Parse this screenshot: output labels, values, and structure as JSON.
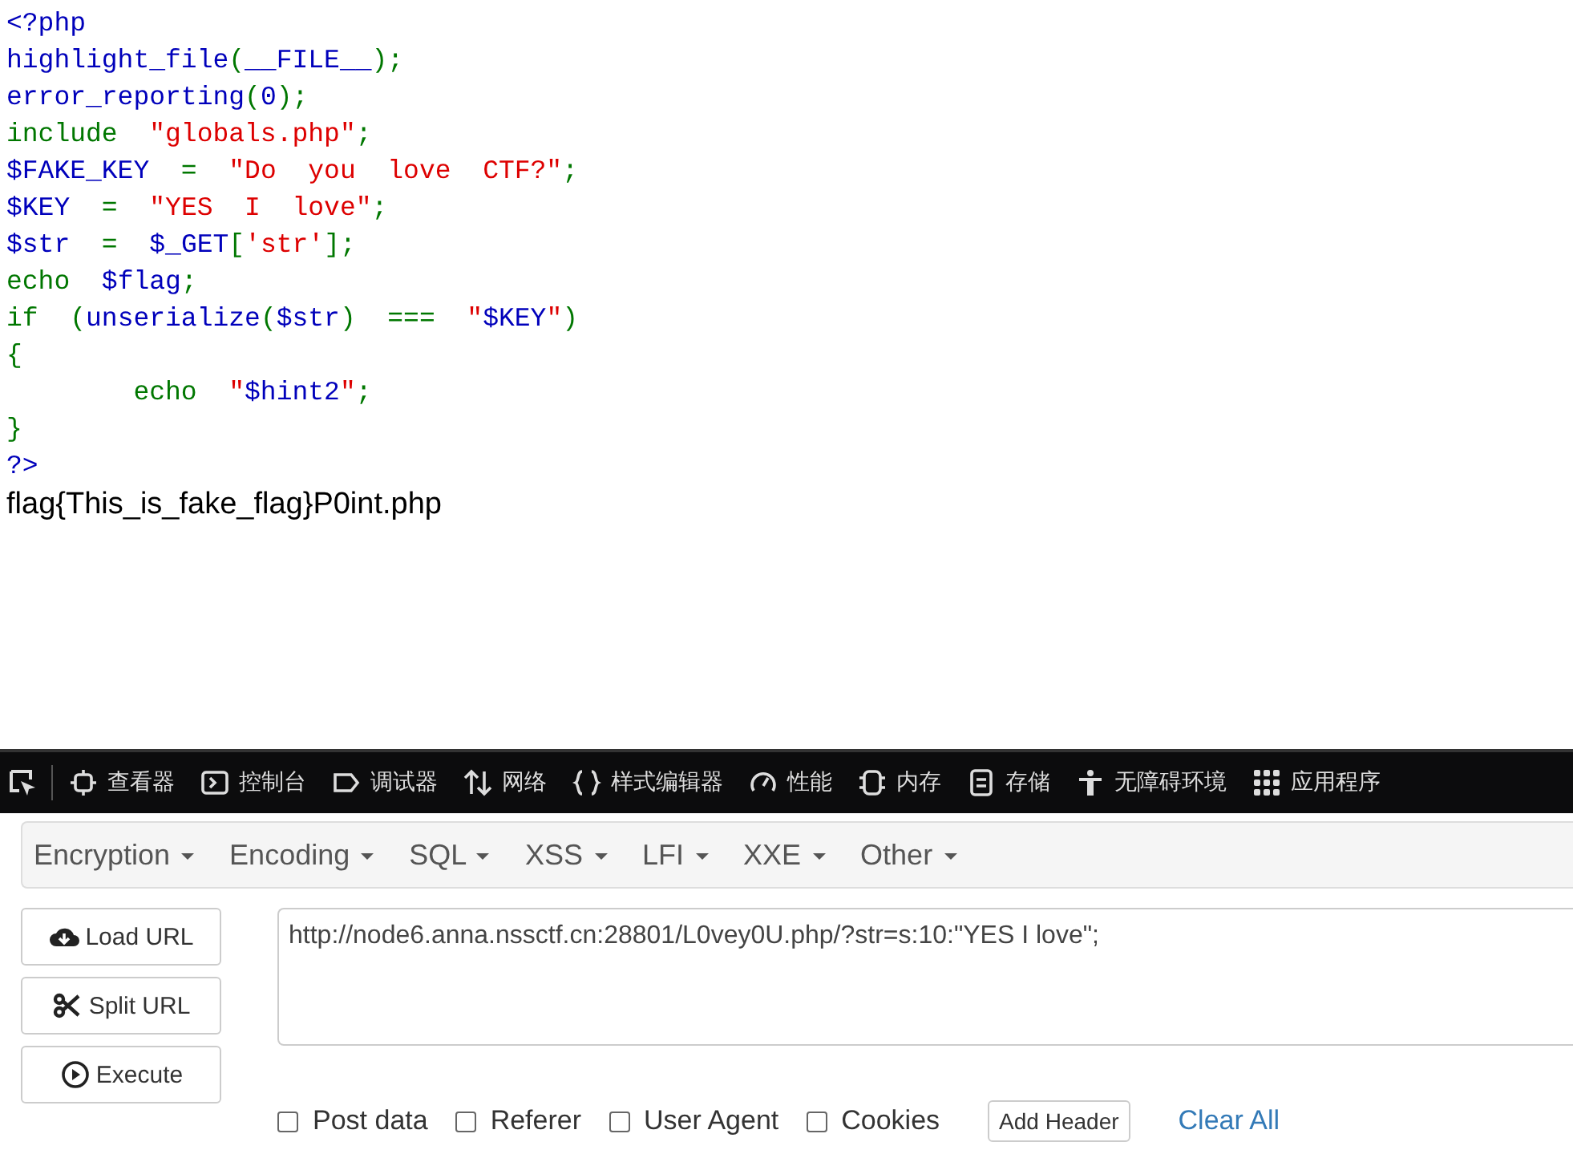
{
  "code_lines": [
    [
      {
        "text": "<?php",
        "kind": "default"
      }
    ],
    [
      {
        "text": "highlight_file",
        "kind": "default"
      },
      {
        "text": "(",
        "kind": "keyword"
      },
      {
        "text": "__FILE__",
        "kind": "default"
      },
      {
        "text": ");",
        "kind": "keyword"
      }
    ],
    [
      {
        "text": "error_reporting",
        "kind": "default"
      },
      {
        "text": "(",
        "kind": "keyword"
      },
      {
        "text": "0",
        "kind": "default"
      },
      {
        "text": ");",
        "kind": "keyword"
      }
    ],
    [
      {
        "text": "include  ",
        "kind": "keyword"
      },
      {
        "text": "\"globals.php\"",
        "kind": "string"
      },
      {
        "text": ";",
        "kind": "keyword"
      }
    ],
    [
      {
        "text": "$FAKE_KEY  ",
        "kind": "default"
      },
      {
        "text": "=  ",
        "kind": "keyword"
      },
      {
        "text": "\"Do  you  love  CTF?\"",
        "kind": "string"
      },
      {
        "text": ";",
        "kind": "keyword"
      }
    ],
    [
      {
        "text": "$KEY  ",
        "kind": "default"
      },
      {
        "text": "=  ",
        "kind": "keyword"
      },
      {
        "text": "\"YES  I  love\"",
        "kind": "string"
      },
      {
        "text": ";",
        "kind": "keyword"
      }
    ],
    [
      {
        "text": "$str  ",
        "kind": "default"
      },
      {
        "text": "=  ",
        "kind": "keyword"
      },
      {
        "text": "$_GET",
        "kind": "default"
      },
      {
        "text": "[",
        "kind": "keyword"
      },
      {
        "text": "'str'",
        "kind": "string"
      },
      {
        "text": "];",
        "kind": "keyword"
      }
    ],
    [
      {
        "text": "echo  ",
        "kind": "keyword"
      },
      {
        "text": "$flag",
        "kind": "default"
      },
      {
        "text": ";",
        "kind": "keyword"
      }
    ],
    [
      {
        "text": "if  (",
        "kind": "keyword"
      },
      {
        "text": "unserialize",
        "kind": "default"
      },
      {
        "text": "(",
        "kind": "keyword"
      },
      {
        "text": "$str",
        "kind": "default"
      },
      {
        "text": ")  ===  ",
        "kind": "keyword"
      },
      {
        "text": "\"",
        "kind": "string"
      },
      {
        "text": "$KEY",
        "kind": "default"
      },
      {
        "text": "\"",
        "kind": "string"
      },
      {
        "text": ")",
        "kind": "keyword"
      }
    ],
    [
      {
        "text": "{",
        "kind": "keyword"
      }
    ],
    [
      {
        "text": "        echo  ",
        "kind": "keyword"
      },
      {
        "text": "\"",
        "kind": "string"
      },
      {
        "text": "$hint2",
        "kind": "default"
      },
      {
        "text": "\"",
        "kind": "string"
      },
      {
        "text": ";",
        "kind": "keyword"
      }
    ],
    [
      {
        "text": "}",
        "kind": "keyword"
      }
    ],
    [
      {
        "text": "?>",
        "kind": "default"
      }
    ]
  ],
  "output": "flag{This_is_fake_flag}P0int.php",
  "devtools_tabs": [
    "查看器",
    "控制台",
    "调试器",
    "网络",
    "样式编辑器",
    "性能",
    "内存",
    "存储",
    "无障碍环境",
    "应用程序"
  ],
  "hackbar": {
    "menus": [
      "Encryption",
      "Encoding",
      "SQL",
      "XSS",
      "LFI",
      "XXE",
      "Other"
    ],
    "buttons": [
      "Load URL",
      "Split URL",
      "Execute"
    ],
    "url": "http://node6.anna.nssctf.cn:28801/L0vey0U.php/?str=s:10:\"YES I love\";",
    "options": [
      {
        "label": "Post data",
        "checked": false
      },
      {
        "label": "Referer",
        "checked": false
      },
      {
        "label": "User Agent",
        "checked": false
      },
      {
        "label": "Cookies",
        "checked": false
      }
    ],
    "add_header": "Add Header",
    "clear_all": "Clear All"
  }
}
